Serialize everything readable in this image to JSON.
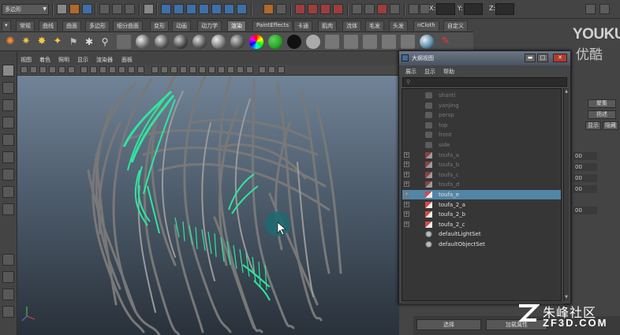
{
  "statusline": {
    "mode_dropdown": "多边形",
    "coords": {
      "x_label": "X:",
      "y_label": "Y:",
      "z_label": "Z:"
    }
  },
  "shelf": {
    "tabs": [
      "常规",
      "曲线",
      "曲面",
      "多边形",
      "细分曲面",
      "变形",
      "动画",
      "动力学",
      "渲染",
      "PaintEffects",
      "卡通",
      "肌肉",
      "流体",
      "毛发",
      "头发",
      "nCloth",
      "自定义"
    ],
    "active_tab": "渲染"
  },
  "panel": {
    "menus": [
      "视图",
      "着色",
      "照明",
      "显示",
      "渲染器",
      "面板"
    ]
  },
  "outliner": {
    "title": "大纲视图",
    "menus": [
      "展示",
      "显示",
      "帮助"
    ],
    "window_buttons": [
      "▬",
      "□",
      "✕"
    ],
    "items": [
      {
        "label": "shanti",
        "kind": "camera",
        "state": "dim",
        "expandable": false,
        "selected": false
      },
      {
        "label": "yanjing",
        "kind": "camera",
        "state": "dim",
        "expandable": false,
        "selected": false
      },
      {
        "label": "persp",
        "kind": "camera",
        "state": "dim",
        "expandable": false,
        "selected": false
      },
      {
        "label": "top",
        "kind": "camera",
        "state": "dim",
        "expandable": false,
        "selected": false
      },
      {
        "label": "front",
        "kind": "camera",
        "state": "dim",
        "expandable": false,
        "selected": false
      },
      {
        "label": "side",
        "kind": "camera",
        "state": "dim",
        "expandable": false,
        "selected": false
      },
      {
        "label": "toufa_a",
        "kind": "curve",
        "state": "dim",
        "expandable": true,
        "selected": false
      },
      {
        "label": "toufa_b",
        "kind": "curve",
        "state": "dim",
        "expandable": true,
        "selected": false
      },
      {
        "label": "toufa_c",
        "kind": "curve",
        "state": "dim",
        "expandable": true,
        "selected": false
      },
      {
        "label": "toufa_d",
        "kind": "curve",
        "state": "dim",
        "expandable": true,
        "selected": false
      },
      {
        "label": "toufa_e",
        "kind": "curve",
        "state": "bright",
        "expandable": true,
        "selected": true
      },
      {
        "label": "toufa_2_a",
        "kind": "curve",
        "state": "bright",
        "expandable": true,
        "selected": false
      },
      {
        "label": "toufa_2_b",
        "kind": "curve",
        "state": "bright",
        "expandable": true,
        "selected": false
      },
      {
        "label": "toufa_2_c",
        "kind": "curve",
        "state": "bright",
        "expandable": true,
        "selected": false
      },
      {
        "label": "defaultLightSet",
        "kind": "set",
        "state": "bright",
        "expandable": false,
        "selected": false
      },
      {
        "label": "defaultObjectSet",
        "kind": "set",
        "state": "bright",
        "expandable": false,
        "selected": false
      }
    ]
  },
  "channel_box": {
    "buttons": [
      "聚集",
      "扬述",
      "显示",
      "隐藏"
    ],
    "values": [
      "00",
      "00",
      "00",
      "00",
      "00"
    ]
  },
  "bottom_bar": {
    "select_label": "选择",
    "load_label": "加载属性"
  },
  "watermarks": {
    "youku": "YOUKU",
    "youku_cn": "优酷",
    "zf_cn": "朱峰社区",
    "zf_en": "ZF3D.COM"
  },
  "colors": {
    "selection": "#5285a6",
    "curve_highlight": "#2ee6a0",
    "hair": "#7a7a7a"
  }
}
